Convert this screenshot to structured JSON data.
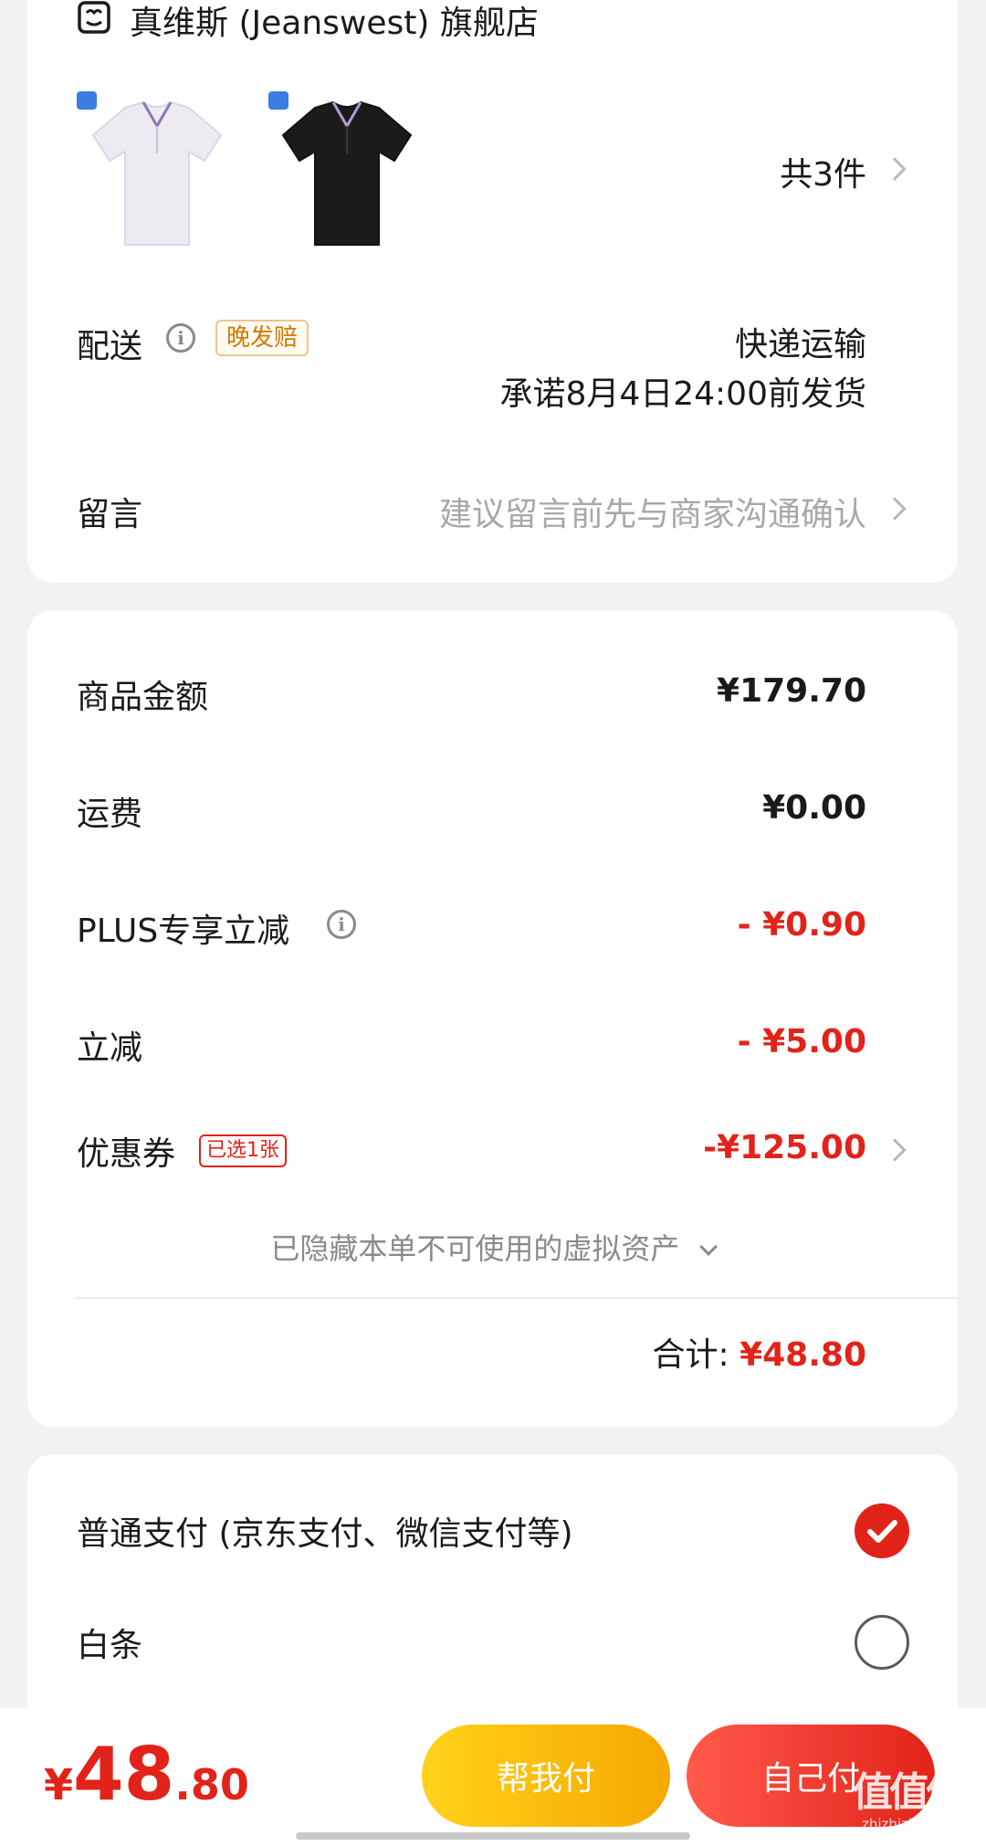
{
  "shop": {
    "name": "真维斯 (Jeanswest) 旗舰店",
    "icon": "shop-icon"
  },
  "products": {
    "count_label": "共3件",
    "items": [
      {
        "color": "white-polo",
        "badge": "blue-badge"
      },
      {
        "color": "black-polo",
        "badge": "blue-badge"
      }
    ]
  },
  "delivery": {
    "label": "配送",
    "tag": "晚发赔",
    "method": "快递运输",
    "promise": "承诺8月4日24:00前发货"
  },
  "message": {
    "label": "留言",
    "placeholder": "建议留言前先与商家沟通确认"
  },
  "summary": {
    "rows": [
      {
        "label": "商品金额",
        "value": "¥179.70"
      },
      {
        "label": "运费",
        "value": "¥0.00"
      },
      {
        "label": "PLUS专享立减",
        "value": "- ¥0.90"
      },
      {
        "label": "立减",
        "value": "- ¥5.00"
      },
      {
        "label": "优惠券",
        "tag": "已选1张",
        "value": "-¥125.00"
      }
    ],
    "hidden_assets": "已隐藏本单不可使用的虚拟资产",
    "total_label": "合计:",
    "total_value": "¥48.80"
  },
  "payment": {
    "options": [
      {
        "label": "普通支付 (京东支付、微信支付等)",
        "selected": true
      },
      {
        "label": "白条",
        "selected": false
      }
    ]
  },
  "bottom": {
    "currency": "¥",
    "price_int": "48",
    "price_dec": ".80",
    "help_pay": "帮我付",
    "self_pay": "自己付",
    "watermark": "值值值",
    "watermark_sub": "zhizhizhi.com"
  },
  "colors": {
    "accent_red": "#e2231a",
    "accent_yellow": "#f7b500",
    "tag_orange": "#d07a00"
  }
}
